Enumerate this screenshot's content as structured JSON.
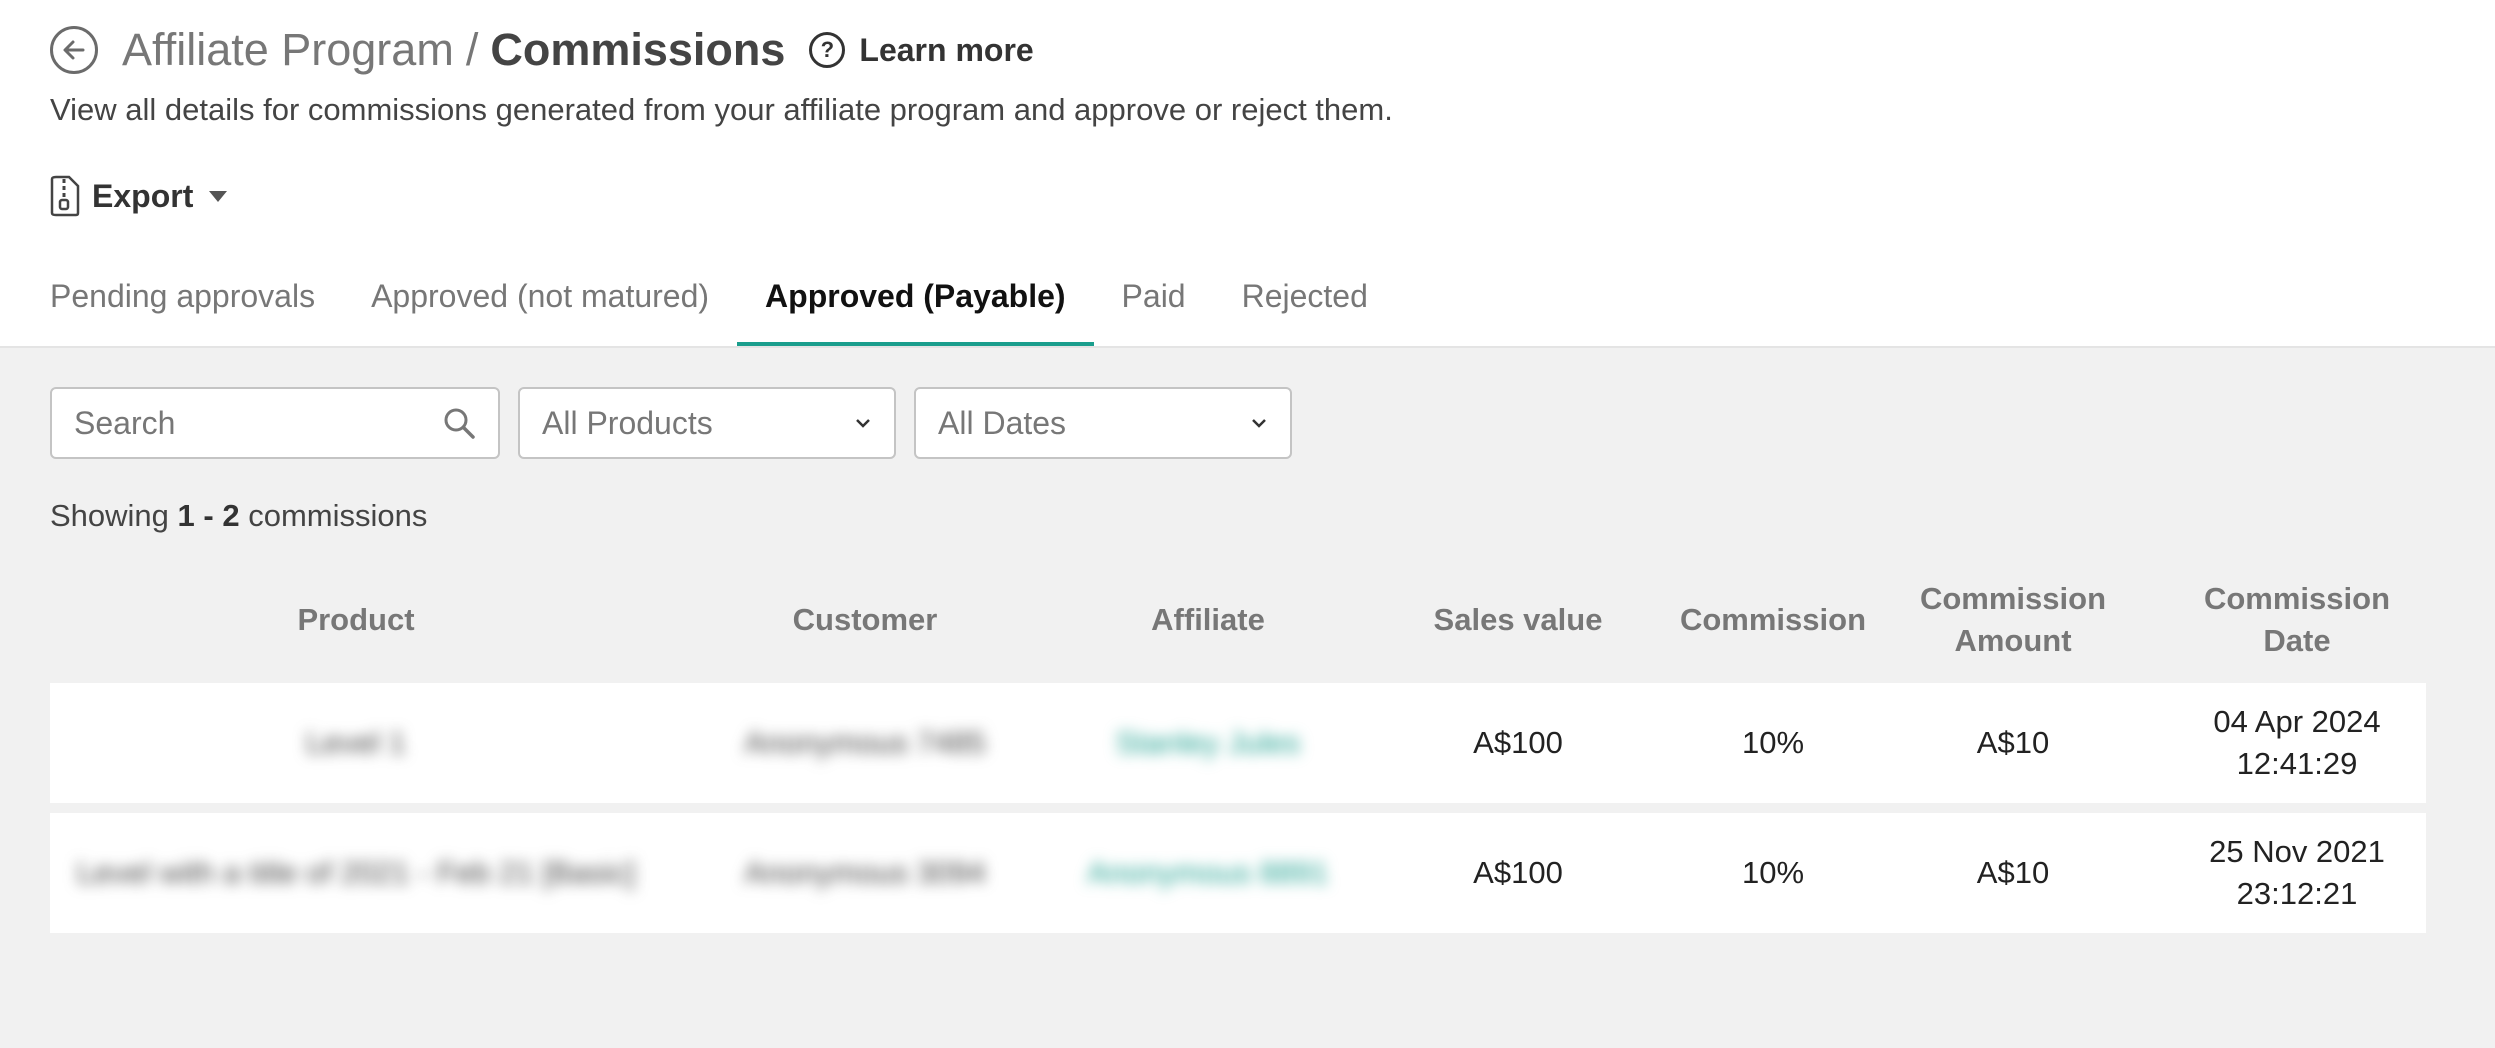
{
  "header": {
    "breadcrumb": "Affiliate Program",
    "separator": "/",
    "page_title": "Commissions",
    "learn_more": "Learn more",
    "subtitle": "View all details for commissions generated from your affiliate program and approve or reject them.",
    "export_label": "Export"
  },
  "tabs": [
    {
      "label": "Pending approvals",
      "active": false
    },
    {
      "label": "Approved (not matured)",
      "active": false
    },
    {
      "label": "Approved (Payable)",
      "active": true
    },
    {
      "label": "Paid",
      "active": false
    },
    {
      "label": "Rejected",
      "active": false
    }
  ],
  "filters": {
    "search_placeholder": "Search",
    "products": "All Products",
    "dates": "All Dates"
  },
  "showing": {
    "prefix": "Showing",
    "range": "1 - 2",
    "suffix": "commissions"
  },
  "columns": {
    "product": "Product",
    "customer": "Customer",
    "affiliate": "Affiliate",
    "sales_value": "Sales value",
    "commission": "Commission",
    "commission_amount_line1": "Commission",
    "commission_amount_line2": "Amount",
    "commission_date": "Commission Date"
  },
  "rows": [
    {
      "product": "Level 1",
      "customer": "Anonymous 7485",
      "affiliate": "Stanley Jules",
      "sales_value": "A$100",
      "commission": "10%",
      "commission_amount": "A$10",
      "date_line1": "04 Apr 2024",
      "date_line2": "12:41:29"
    },
    {
      "product": "Level with a title of 2021 - Feb 21 [Basic]",
      "customer": "Anonymous 3094",
      "affiliate": "Anonymous 8891",
      "sales_value": "A$100",
      "commission": "10%",
      "commission_amount": "A$10",
      "date_line1": "25 Nov 2021",
      "date_line2": "23:12:21"
    }
  ],
  "colors": {
    "accent": "#1a9e8d",
    "content_bg": "#f1f1f1"
  },
  "icons": {
    "back": "back-arrow-circle-icon",
    "help": "question-circle-icon",
    "export": "zip-file-icon",
    "search": "search-icon",
    "dropdown": "chevron-down-icon"
  }
}
